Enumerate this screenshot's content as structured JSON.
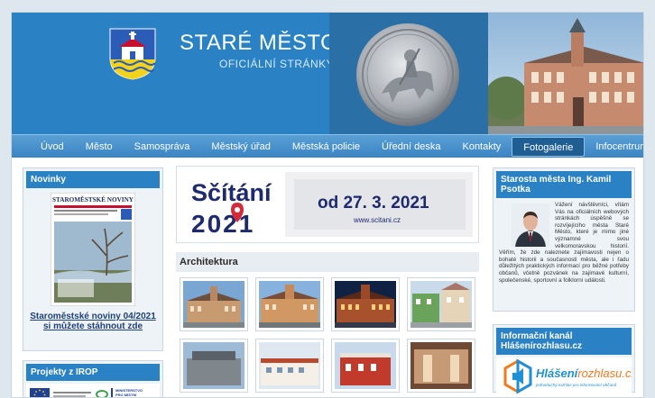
{
  "header": {
    "title": "STARÉ MĚSTO",
    "subtitle": "OFICIÁLNÍ STRÁNKY"
  },
  "nav": {
    "items": [
      {
        "label": "Úvod"
      },
      {
        "label": "Město"
      },
      {
        "label": "Samospráva"
      },
      {
        "label": "Městský úřad"
      },
      {
        "label": "Městská policie"
      },
      {
        "label": "Úřední deska"
      },
      {
        "label": "Kontakty"
      },
      {
        "label": "Fotogalerie"
      },
      {
        "label": "Infocentrum"
      }
    ],
    "active": "Fotogalerie"
  },
  "left": {
    "news_title": "Novinky",
    "newspaper_title": "STAROMĚSTSKÉ NOVINY",
    "news_link": "Staroměstské noviny 04/2021 si můžete stáhnout zde",
    "irop_title": "Projekty z IROP",
    "irop_ministry": "MINISTERSTVO PRO MÍSTNÍ ROZVOJ ČR"
  },
  "banner": {
    "word": "Sčítání",
    "year": "2021",
    "date": "od 27. 3. 2021",
    "url": "www.scitani.cz"
  },
  "gallery": {
    "section_title": "Architektura"
  },
  "right": {
    "mayor_title": "Starosta města Ing. Kamil Psotka",
    "mayor_text": "Vážení návštěvníci, vítám Vás na oficiálních webových stránkách úspěšně se rozvíjejícího města Staré Město, které je mimo jiné významné svou velkomoravskou historií. Věřím, že zde naleznete zajímavosti nejen o bohaté historii a současnosti města, ale i řadu důležitých praktických informací pro běžné potřeby občanů, včetně pozvánek na zajímavé kulturní, společenské, sportovní a folklorní události.",
    "kanal_title": "Informační kanál Hlášenírozhlasu.cz",
    "kanal_brand_a": "Hlášení",
    "kanal_brand_b": "rozhlasu.cz",
    "kanal_tagline": "jednoduchý rozhlas pro informování občanů"
  },
  "colors": {
    "header_blue": "#2a81c4",
    "nav_active": "#1f5e93",
    "sidebar_head": "#2a81c4",
    "census_navy": "#1e2a6e",
    "census_red": "#d32b3a"
  }
}
